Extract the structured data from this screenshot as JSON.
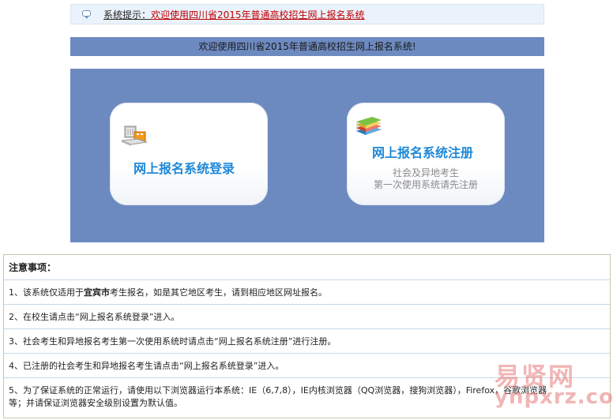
{
  "notice": {
    "label": "系统提示：",
    "text": "欢迎使用四川省2015年普通高校招生网上报名系统"
  },
  "welcome": {
    "text": "欢迎使用四川省2015年普通高校招生网上报名系统!"
  },
  "cards": {
    "login": {
      "title": "网上报名系统登录",
      "icon": "computer-icon"
    },
    "register": {
      "title": "网上报名系统注册",
      "sub1": "社会及异地考生",
      "sub2": "第一次使用系统请先注册",
      "icon": "books-icon"
    }
  },
  "notes": {
    "heading": "注意事项：",
    "items": {
      "1a": "1、该系统仅适用于",
      "1b": "宜宾市",
      "1c": "考生报名，如是其它地区考生，请到相应地区网址报名。",
      "2": "2、在校生请点击“网上报名系统登录”进入。",
      "3": "3、社会考生和异地报名考生第一次使用系统时请点击“网上报名系统注册”进行注册。",
      "4": "4、已注册的社会考生和异地报名考生请点击“网上报名系统登录”进入。",
      "5a": "5、为了保证系统的正常运行，请使用以下浏览器运行本系统：IE（6,7,8），IE内核浏览器（QQ浏览器，搜狗浏览器），Firefox，谷歌浏览器",
      "5b": "等；并请保证浏览器安全级别设置为默认值。"
    }
  },
  "watermark": {
    "cn": "易贤网",
    "en": "ynpxrz.com"
  },
  "colors": {
    "panel": "#6d8ac0",
    "title_blue": "#1e88d8",
    "notice_red": "#c00000"
  }
}
